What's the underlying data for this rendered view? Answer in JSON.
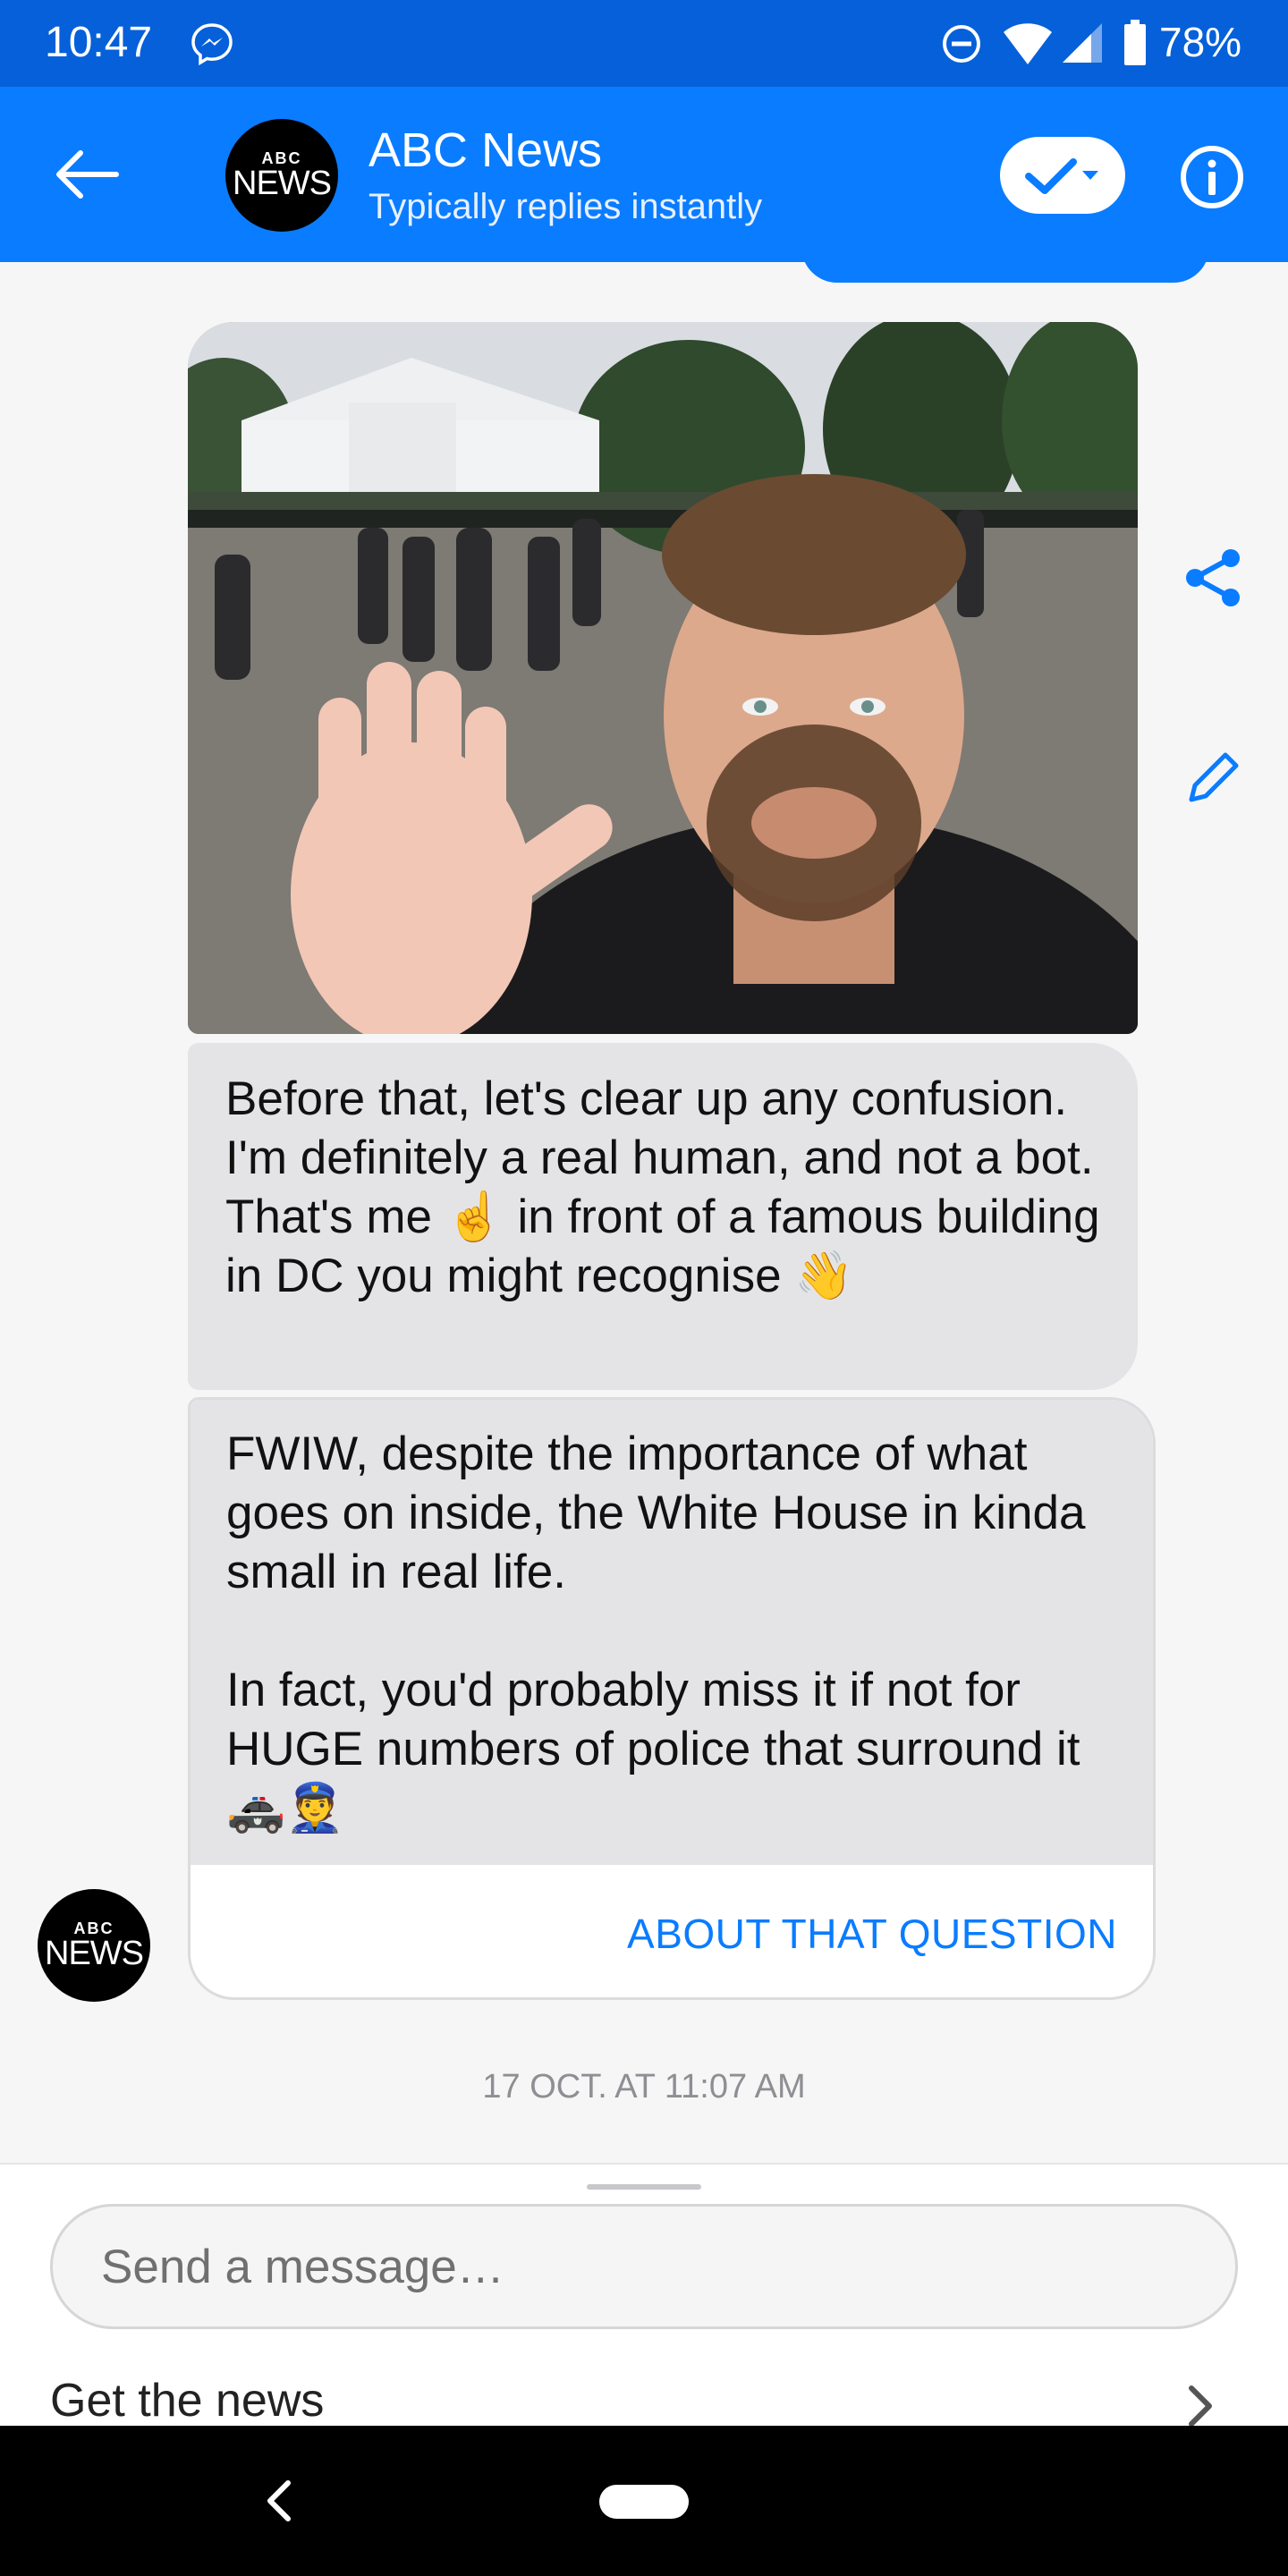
{
  "status_bar": {
    "time": "10:47",
    "battery": "78%"
  },
  "header": {
    "avatar_top": "ABC",
    "avatar_bottom": "NEWS",
    "name": "ABC News",
    "subtitle": "Typically replies instantly"
  },
  "messages": {
    "bubble1_text": "Before that, let's clear up any confusion. I'm definitely a real human, and not a bot. That's me ☝️ in front of a famous building in DC you might recognise 👋",
    "card_text": "FWIW, despite the importance of what goes on inside, the White House in kinda small in real life.\n\nIn fact, you'd probably miss it if not for HUGE numbers of police that surround it 🚓👮",
    "card_button": "ABOUT THAT QUESTION",
    "timestamp": "17 OCT. AT 11:07 AM"
  },
  "composer": {
    "placeholder": "Send a message…",
    "menu_item": "Get the news"
  },
  "colors": {
    "status_bar": "#0560d9",
    "header": "#0a7cff",
    "accent": "#0a7cff",
    "bubble": "#e4e4e6"
  },
  "icons": [
    "messenger-icon",
    "dnd-icon",
    "wifi-icon",
    "cellular-icon",
    "battery-icon",
    "back-arrow-icon",
    "check-dropdown-icon",
    "info-icon",
    "share-icon",
    "edit-icon",
    "chevron-right-icon",
    "nav-back-icon",
    "home-pill-icon"
  ]
}
